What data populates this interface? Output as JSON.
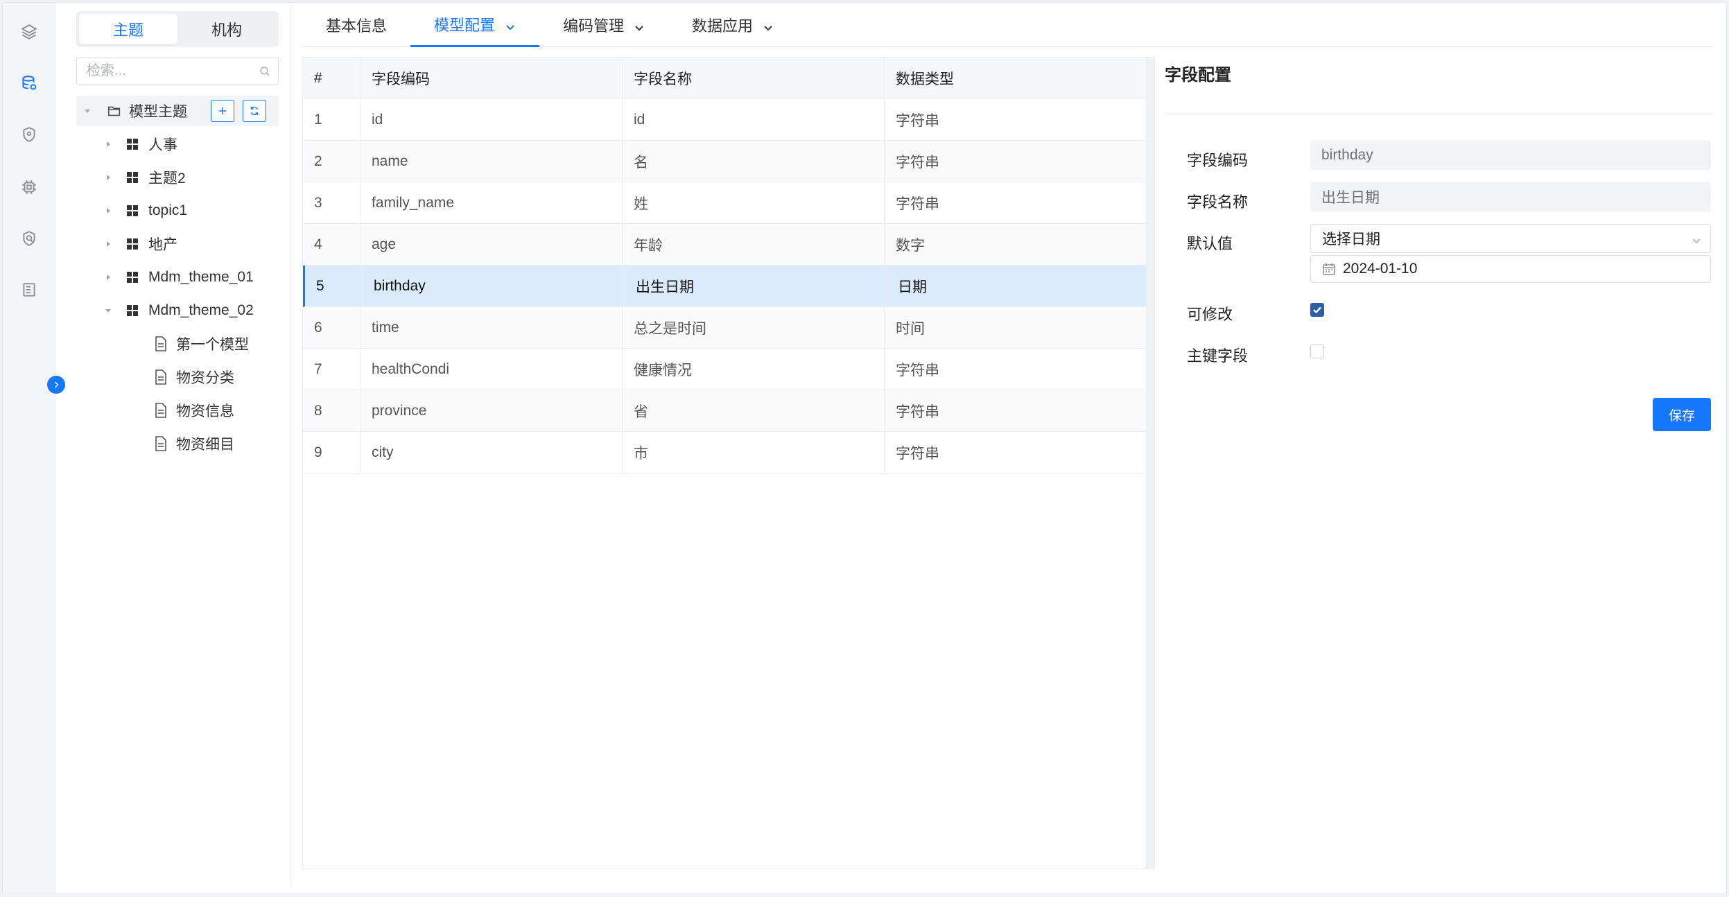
{
  "rail": {
    "icons": [
      "layers-icon",
      "database-icon",
      "shield-location-icon",
      "chip-icon",
      "shield-check-icon",
      "document-list-icon"
    ],
    "active": "database-icon"
  },
  "tree": {
    "segments": [
      {
        "label": "主题",
        "active": true
      },
      {
        "label": "机构",
        "active": false
      }
    ],
    "search_placeholder": "检索...",
    "root_label": "模型主题",
    "nodes": [
      {
        "label": "人事"
      },
      {
        "label": "主题2"
      },
      {
        "label": "topic1"
      },
      {
        "label": "地产"
      },
      {
        "label": "Mdm_theme_01"
      },
      {
        "label": "Mdm_theme_02",
        "expanded": true
      }
    ],
    "children": [
      {
        "label": "第一个模型"
      },
      {
        "label": "物资分类"
      },
      {
        "label": "物资信息"
      },
      {
        "label": "物资细目"
      }
    ]
  },
  "tabs": [
    {
      "label": "基本信息"
    },
    {
      "label": "模型配置",
      "active": true
    },
    {
      "label": "编码管理"
    },
    {
      "label": "数据应用"
    }
  ],
  "table": {
    "headers": [
      "#",
      "字段编码",
      "字段名称",
      "数据类型"
    ],
    "rows": [
      [
        "1",
        "id",
        "id",
        "字符串"
      ],
      [
        "2",
        "name",
        "名",
        "字符串"
      ],
      [
        "3",
        "family_name",
        "姓",
        "字符串"
      ],
      [
        "4",
        "age",
        "年龄",
        "数字"
      ],
      [
        "5",
        "birthday",
        "出生日期",
        "日期"
      ],
      [
        "6",
        "time",
        "总之是时间",
        "时间"
      ],
      [
        "7",
        "healthCondi",
        "健康情况",
        "字符串"
      ],
      [
        "8",
        "province",
        "省",
        "字符串"
      ],
      [
        "9",
        "city",
        "市",
        "字符串"
      ]
    ],
    "selected_row": "5"
  },
  "side": {
    "title": "字段配置",
    "code_label": "字段编码",
    "code_value": "birthday",
    "name_label": "字段名称",
    "name_value": "出生日期",
    "default_label": "默认值",
    "default_select": "选择日期",
    "default_date": "2024-01-10",
    "editable_label": "可修改",
    "editable_checked": true,
    "pk_label": "主键字段",
    "pk_checked": false,
    "save_label": "保存"
  },
  "colors": {
    "accent": "#1677ff",
    "selected_row": "#dcebfb",
    "checkbox_checked": "#2f5ea8"
  }
}
